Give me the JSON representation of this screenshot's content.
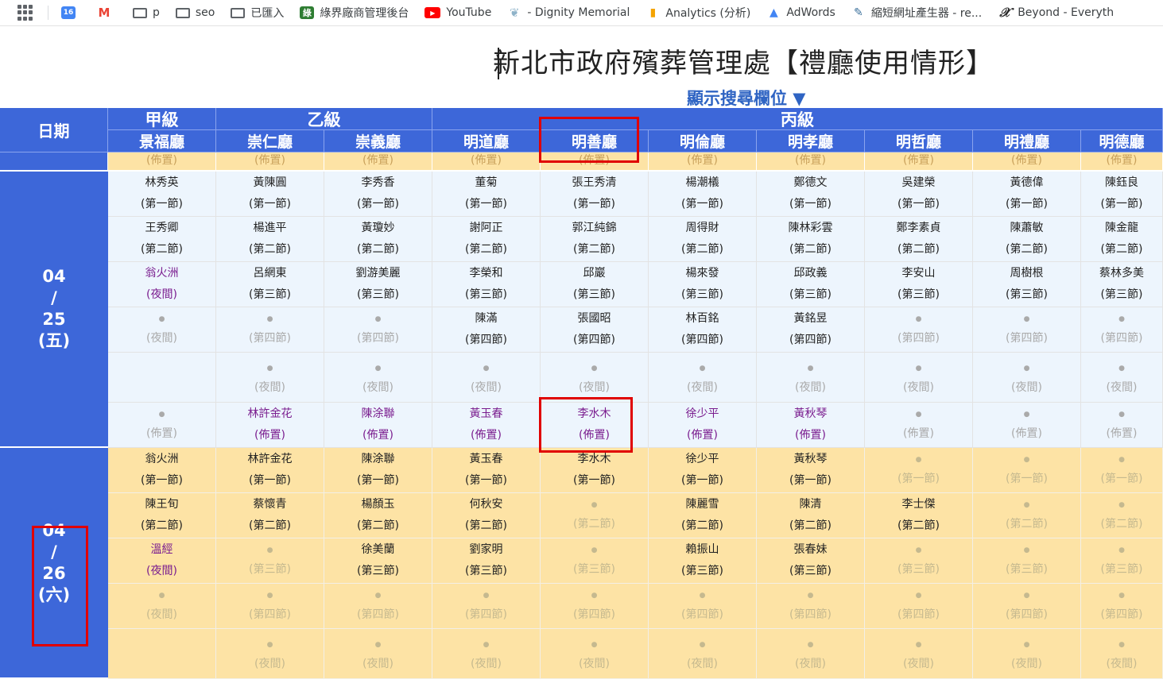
{
  "bookmarks": [
    {
      "label": "",
      "icon": "calendar-icon",
      "cls": "cal",
      "glyph": "16"
    },
    {
      "label": "",
      "icon": "gmail-icon",
      "cls": "gm",
      "glyph": "M"
    },
    {
      "label": "p",
      "icon": "folder-icon",
      "cls": "fold",
      "glyph": ""
    },
    {
      "label": "seo",
      "icon": "folder-icon",
      "cls": "fold",
      "glyph": ""
    },
    {
      "label": "已匯入",
      "icon": "folder-icon",
      "cls": "fold",
      "glyph": ""
    },
    {
      "label": "綠界廠商管理後台",
      "icon": "ecpay-icon",
      "cls": "grn",
      "glyph": "綠"
    },
    {
      "label": "YouTube",
      "icon": "youtube-icon",
      "cls": "yt",
      "glyph": "▶"
    },
    {
      "label": "- Dignity Memorial",
      "icon": "dignity-icon",
      "cls": "dig",
      "glyph": "❦"
    },
    {
      "label": "Analytics (分析)",
      "icon": "analytics-icon",
      "cls": "ana",
      "glyph": "▮"
    },
    {
      "label": "AdWords",
      "icon": "adwords-icon",
      "cls": "adw",
      "glyph": "▲"
    },
    {
      "label": "縮短網址產生器 - re...",
      "icon": "url-shortener-icon",
      "cls": "url",
      "glyph": "✎"
    },
    {
      "label": "Beyond - Everyth",
      "icon": "beyond-icon",
      "cls": "bey",
      "glyph": "𝒳"
    }
  ],
  "header": {
    "title": "新北市政府殯葬管理處【禮廳使用情形】",
    "search_toggle": "顯示搜尋欄位 ▼"
  },
  "table": {
    "date_header": "日期",
    "grades": [
      "甲級",
      "乙級",
      "丙級"
    ],
    "halls": [
      "景福廳",
      "崇仁廳",
      "崇義廳",
      "明道廳",
      "明善廳",
      "明倫廳",
      "明孝廳",
      "明哲廳",
      "明禮廳",
      "明德廳"
    ],
    "layout_label": "(佈置)",
    "days": [
      {
        "date": [
          "04",
          "/",
          "25",
          "(五)"
        ],
        "rows": [
          [
            [
              "林秀英",
              "(第一節)",
              "n"
            ],
            [
              "黃陳圓",
              "(第一節)",
              "n"
            ],
            [
              "李秀香",
              "(第一節)",
              "n"
            ],
            [
              "董菊",
              "(第一節)",
              "n"
            ],
            [
              "張王秀清",
              "(第一節)",
              "n"
            ],
            [
              "楊潮檥",
              "(第一節)",
              "n"
            ],
            [
              "鄭德文",
              "(第一節)",
              "n"
            ],
            [
              "吳建榮",
              "(第一節)",
              "n"
            ],
            [
              "黃德偉",
              "(第一節)",
              "n"
            ],
            [
              "陳鈺良",
              "(第一節)",
              "n"
            ]
          ],
          [
            [
              "王秀卿",
              "(第二節)",
              "n"
            ],
            [
              "楊進平",
              "(第二節)",
              "n"
            ],
            [
              "黃瓊妙",
              "(第二節)",
              "n"
            ],
            [
              "謝阿正",
              "(第二節)",
              "n"
            ],
            [
              "郭江純錦",
              "(第二節)",
              "n"
            ],
            [
              "周得財",
              "(第二節)",
              "n"
            ],
            [
              "陳林彩雲",
              "(第二節)",
              "n"
            ],
            [
              "鄭李素貞",
              "(第二節)",
              "n"
            ],
            [
              "陳蕭敏",
              "(第二節)",
              "n"
            ],
            [
              "陳金龍",
              "(第二節)",
              "n"
            ]
          ],
          [
            [
              "翁火洲",
              "(夜間)",
              "p"
            ],
            [
              "呂網東",
              "(第三節)",
              "n"
            ],
            [
              "劉游美麗",
              "(第三節)",
              "n"
            ],
            [
              "李榮和",
              "(第三節)",
              "n"
            ],
            [
              "邱巖",
              "(第三節)",
              "n"
            ],
            [
              "楊來發",
              "(第三節)",
              "n"
            ],
            [
              "邱政義",
              "(第三節)",
              "n"
            ],
            [
              "李安山",
              "(第三節)",
              "n"
            ],
            [
              "周樹根",
              "(第三節)",
              "n"
            ],
            [
              "蔡林多美",
              "(第三節)",
              "n"
            ]
          ],
          [
            [
              "●",
              "(夜間)",
              "g"
            ],
            [
              "●",
              "(第四節)",
              "g"
            ],
            [
              "●",
              "(第四節)",
              "g"
            ],
            [
              "陳滿",
              "(第四節)",
              "n"
            ],
            [
              "張國昭",
              "(第四節)",
              "n"
            ],
            [
              "林百銘",
              "(第四節)",
              "n"
            ],
            [
              "黃銘昱",
              "(第四節)",
              "n"
            ],
            [
              "●",
              "(第四節)",
              "g"
            ],
            [
              "●",
              "(第四節)",
              "g"
            ],
            [
              "●",
              "(第四節)",
              "g"
            ]
          ],
          [
            [
              "",
              "",
              "e"
            ],
            [
              "●",
              "(夜間)",
              "g"
            ],
            [
              "●",
              "(夜間)",
              "g"
            ],
            [
              "●",
              "(夜間)",
              "g"
            ],
            [
              "●",
              "(夜間)",
              "g"
            ],
            [
              "●",
              "(夜間)",
              "g"
            ],
            [
              "●",
              "(夜間)",
              "g"
            ],
            [
              "●",
              "(夜間)",
              "g"
            ],
            [
              "●",
              "(夜間)",
              "g"
            ],
            [
              "●",
              "(夜間)",
              "g"
            ]
          ],
          [
            [
              "●",
              "(佈置)",
              "g"
            ],
            [
              "林許金花",
              "(佈置)",
              "p"
            ],
            [
              "陳涂聯",
              "(佈置)",
              "p"
            ],
            [
              "黃玉春",
              "(佈置)",
              "p"
            ],
            [
              "李水木",
              "(佈置)",
              "p"
            ],
            [
              "徐少平",
              "(佈置)",
              "p"
            ],
            [
              "黃秋琴",
              "(佈置)",
              "p"
            ],
            [
              "●",
              "(佈置)",
              "g"
            ],
            [
              "●",
              "(佈置)",
              "g"
            ],
            [
              "●",
              "(佈置)",
              "g"
            ]
          ]
        ]
      },
      {
        "date": [
          "04",
          "/",
          "26",
          "(六)"
        ],
        "rows": [
          [
            [
              "翁火洲",
              "(第一節)",
              "n"
            ],
            [
              "林許金花",
              "(第一節)",
              "n"
            ],
            [
              "陳涂聯",
              "(第一節)",
              "n"
            ],
            [
              "黃玉春",
              "(第一節)",
              "n"
            ],
            [
              "李水木",
              "(第一節)",
              "n"
            ],
            [
              "徐少平",
              "(第一節)",
              "n"
            ],
            [
              "黃秋琴",
              "(第一節)",
              "n"
            ],
            [
              "●",
              "(第一節)",
              "g"
            ],
            [
              "●",
              "(第一節)",
              "g"
            ],
            [
              "●",
              "(第一節)",
              "g"
            ]
          ],
          [
            [
              "陳王旬",
              "(第二節)",
              "n"
            ],
            [
              "蔡懷青",
              "(第二節)",
              "n"
            ],
            [
              "楊顏玉",
              "(第二節)",
              "n"
            ],
            [
              "何秋安",
              "(第二節)",
              "n"
            ],
            [
              "●",
              "(第二節)",
              "g"
            ],
            [
              "陳麗雪",
              "(第二節)",
              "n"
            ],
            [
              "陳清",
              "(第二節)",
              "n"
            ],
            [
              "李士傑",
              "(第二節)",
              "n"
            ],
            [
              "●",
              "(第二節)",
              "g"
            ],
            [
              "●",
              "(第二節)",
              "g"
            ]
          ],
          [
            [
              "溫經",
              "(夜間)",
              "p"
            ],
            [
              "●",
              "(第三節)",
              "g"
            ],
            [
              "徐美蘭",
              "(第三節)",
              "n"
            ],
            [
              "劉家明",
              "(第三節)",
              "n"
            ],
            [
              "●",
              "(第三節)",
              "g"
            ],
            [
              "賴振山",
              "(第三節)",
              "n"
            ],
            [
              "張春妹",
              "(第三節)",
              "n"
            ],
            [
              "●",
              "(第三節)",
              "g"
            ],
            [
              "●",
              "(第三節)",
              "g"
            ],
            [
              "●",
              "(第三節)",
              "g"
            ]
          ],
          [
            [
              "●",
              "(夜間)",
              "g"
            ],
            [
              "●",
              "(第四節)",
              "g"
            ],
            [
              "●",
              "(第四節)",
              "g"
            ],
            [
              "●",
              "(第四節)",
              "g"
            ],
            [
              "●",
              "(第四節)",
              "g"
            ],
            [
              "●",
              "(第四節)",
              "g"
            ],
            [
              "●",
              "(第四節)",
              "g"
            ],
            [
              "●",
              "(第四節)",
              "g"
            ],
            [
              "●",
              "(第四節)",
              "g"
            ],
            [
              "●",
              "(第四節)",
              "g"
            ]
          ],
          [
            [
              "",
              "",
              "e"
            ],
            [
              "●",
              "(夜間)",
              "g"
            ],
            [
              "●",
              "(夜間)",
              "g"
            ],
            [
              "●",
              "(夜間)",
              "g"
            ],
            [
              "●",
              "(夜間)",
              "g"
            ],
            [
              "●",
              "(夜間)",
              "g"
            ],
            [
              "●",
              "(夜間)",
              "g"
            ],
            [
              "●",
              "(夜間)",
              "g"
            ],
            [
              "●",
              "(夜間)",
              "g"
            ],
            [
              "●",
              "(夜間)",
              "g"
            ]
          ]
        ]
      }
    ]
  },
  "colors": {
    "header_blue": "#3d67d9",
    "day1_bg": "#edf5fd",
    "day2_bg": "#fde3a5",
    "purple": "#7a1d8f",
    "highlight": "#e00000"
  }
}
